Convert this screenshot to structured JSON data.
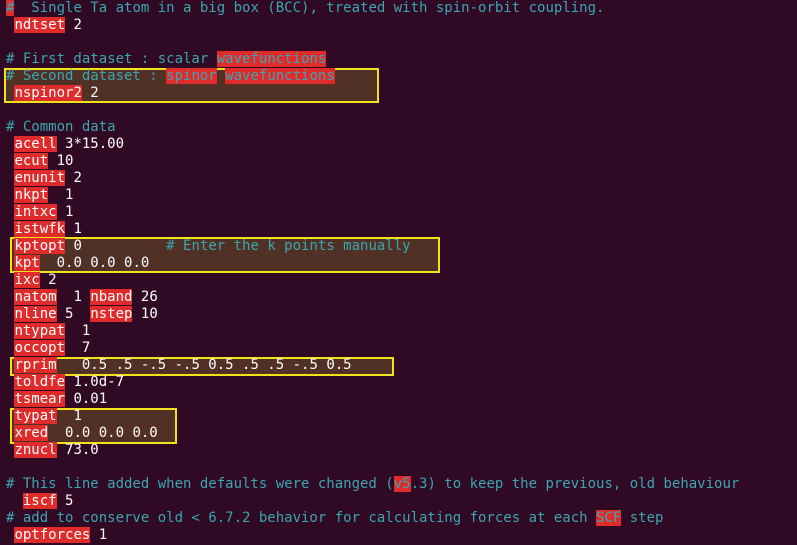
{
  "editor": {
    "lines": [
      {
        "parts": [
          {
            "t": "#",
            "c": "kwc"
          },
          {
            "t": "  Single Ta atom in a big box (BCC), treated with spin-orbit coupling.",
            "c": "comment"
          }
        ]
      },
      {
        "parts": [
          {
            "t": " "
          },
          {
            "t": "ndtset",
            "c": "kw"
          },
          {
            "t": " 2"
          }
        ]
      },
      {
        "parts": []
      },
      {
        "parts": [
          {
            "t": "# First dataset : scalar ",
            "c": "comment"
          },
          {
            "t": "wavefunctions",
            "c": "kwc"
          }
        ]
      },
      {
        "parts": [
          {
            "t": "# Second dataset : ",
            "c": "comment"
          },
          {
            "t": "spinor",
            "c": "kwc"
          },
          {
            "t": " ",
            "c": "comment"
          },
          {
            "t": "wavefunctions",
            "c": "kwc"
          }
        ]
      },
      {
        "parts": [
          {
            "t": " "
          },
          {
            "t": "nspinor2",
            "c": "kw"
          },
          {
            "t": " 2"
          }
        ]
      },
      {
        "parts": []
      },
      {
        "parts": [
          {
            "t": "# Common data",
            "c": "comment"
          }
        ]
      },
      {
        "parts": [
          {
            "t": " "
          },
          {
            "t": "acell",
            "c": "kw"
          },
          {
            "t": " 3*15.00"
          }
        ]
      },
      {
        "parts": [
          {
            "t": " "
          },
          {
            "t": "ecut",
            "c": "kw"
          },
          {
            "t": " 10"
          }
        ]
      },
      {
        "parts": [
          {
            "t": " "
          },
          {
            "t": "enunit",
            "c": "kw"
          },
          {
            "t": " 2"
          }
        ]
      },
      {
        "parts": [
          {
            "t": " "
          },
          {
            "t": "nkpt",
            "c": "kw"
          },
          {
            "t": "  1"
          }
        ]
      },
      {
        "parts": [
          {
            "t": " "
          },
          {
            "t": "intxc",
            "c": "kw"
          },
          {
            "t": " 1"
          }
        ]
      },
      {
        "parts": [
          {
            "t": " "
          },
          {
            "t": "istwfk",
            "c": "kw"
          },
          {
            "t": " 1"
          }
        ]
      },
      {
        "parts": [
          {
            "t": " "
          },
          {
            "t": "kptopt",
            "c": "kw"
          },
          {
            "t": " 0          "
          },
          {
            "t": "# Enter the k points manually",
            "c": "comment"
          }
        ]
      },
      {
        "parts": [
          {
            "t": " "
          },
          {
            "t": "kpt",
            "c": "kw"
          },
          {
            "t": "  0.0 0.0 0.0"
          }
        ]
      },
      {
        "parts": [
          {
            "t": " "
          },
          {
            "t": "ixc",
            "c": "kw"
          },
          {
            "t": " 2"
          }
        ]
      },
      {
        "parts": [
          {
            "t": " "
          },
          {
            "t": "natom",
            "c": "kw"
          },
          {
            "t": "  1 "
          },
          {
            "t": "nband",
            "c": "kw"
          },
          {
            "t": " 26"
          }
        ]
      },
      {
        "parts": [
          {
            "t": " "
          },
          {
            "t": "nline",
            "c": "kw"
          },
          {
            "t": " 5  "
          },
          {
            "t": "nstep",
            "c": "kw"
          },
          {
            "t": " 10"
          }
        ]
      },
      {
        "parts": [
          {
            "t": " "
          },
          {
            "t": "ntypat",
            "c": "kw"
          },
          {
            "t": "  1"
          }
        ]
      },
      {
        "parts": [
          {
            "t": " "
          },
          {
            "t": "occopt",
            "c": "kw"
          },
          {
            "t": "  7"
          }
        ]
      },
      {
        "parts": [
          {
            "t": " "
          },
          {
            "t": "rprim",
            "c": "kw"
          },
          {
            "t": "   0.5 .5 -.5 -.5 0.5 .5 .5 -.5 0.5"
          }
        ]
      },
      {
        "parts": [
          {
            "t": " "
          },
          {
            "t": "toldfe",
            "c": "kw"
          },
          {
            "t": " 1.0d-7"
          }
        ]
      },
      {
        "parts": [
          {
            "t": " "
          },
          {
            "t": "tsmear",
            "c": "kw"
          },
          {
            "t": " 0.01"
          }
        ]
      },
      {
        "parts": [
          {
            "t": " "
          },
          {
            "t": "typat",
            "c": "kw"
          },
          {
            "t": "  1"
          }
        ]
      },
      {
        "parts": [
          {
            "t": " "
          },
          {
            "t": "xred",
            "c": "kw"
          },
          {
            "t": "  0.0 0.0 0.0"
          }
        ]
      },
      {
        "parts": [
          {
            "t": " "
          },
          {
            "t": "znucl",
            "c": "kw"
          },
          {
            "t": " 73.0"
          }
        ]
      },
      {
        "parts": []
      },
      {
        "parts": [
          {
            "t": "# This line added when defaults were changed (",
            "c": "comment"
          },
          {
            "t": "v5",
            "c": "kwc"
          },
          {
            "t": ".3) to keep the previous, old behaviour",
            "c": "comment"
          }
        ]
      },
      {
        "parts": [
          {
            "t": "  "
          },
          {
            "t": "iscf",
            "c": "kw"
          },
          {
            "t": " 5"
          }
        ]
      },
      {
        "parts": [
          {
            "t": "# add to conserve old < 6.7.2 behavior for calculating forces at each ",
            "c": "comment"
          },
          {
            "t": "SCF",
            "c": "kwc"
          },
          {
            "t": " step",
            "c": "comment"
          }
        ]
      },
      {
        "parts": [
          {
            "t": " "
          },
          {
            "t": "optforces",
            "c": "kw"
          },
          {
            "t": " 1"
          }
        ]
      }
    ]
  },
  "colors": {
    "background": "#300a24",
    "comment": "#3aa6b0",
    "keyword_bg": "#e02b2b",
    "highlight_border": "#f2e21b"
  }
}
